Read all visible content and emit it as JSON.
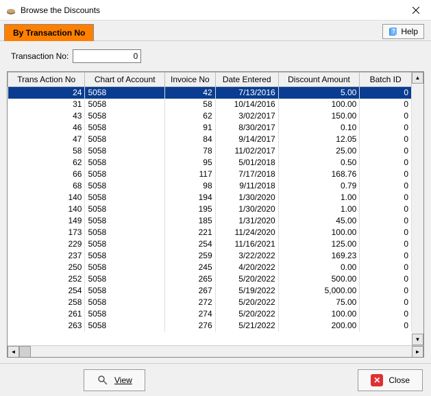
{
  "window": {
    "title": "Browse the Discounts"
  },
  "tab": {
    "label": "By Transaction No"
  },
  "help": {
    "label": "Help"
  },
  "filter": {
    "label": "Transaction No:",
    "value": "0"
  },
  "columns": [
    "Trans Action No",
    "Chart of Account",
    "Invoice No",
    "Date Entered",
    "Discount Amount",
    "Batch ID"
  ],
  "rows": [
    {
      "trans": "24",
      "chart": "5058",
      "inv": "42",
      "date": "7/13/2016",
      "disc": "5.00",
      "batch": "0",
      "selected": true
    },
    {
      "trans": "31",
      "chart": "5058",
      "inv": "58",
      "date": "10/14/2016",
      "disc": "100.00",
      "batch": "0"
    },
    {
      "trans": "43",
      "chart": "5058",
      "inv": "62",
      "date": "3/02/2017",
      "disc": "150.00",
      "batch": "0"
    },
    {
      "trans": "46",
      "chart": "5058",
      "inv": "91",
      "date": "8/30/2017",
      "disc": "0.10",
      "batch": "0"
    },
    {
      "trans": "47",
      "chart": "5058",
      "inv": "84",
      "date": "9/14/2017",
      "disc": "12.05",
      "batch": "0"
    },
    {
      "trans": "58",
      "chart": "5058",
      "inv": "78",
      "date": "11/02/2017",
      "disc": "25.00",
      "batch": "0"
    },
    {
      "trans": "62",
      "chart": "5058",
      "inv": "95",
      "date": "5/01/2018",
      "disc": "0.50",
      "batch": "0"
    },
    {
      "trans": "66",
      "chart": "5058",
      "inv": "117",
      "date": "7/17/2018",
      "disc": "168.76",
      "batch": "0"
    },
    {
      "trans": "68",
      "chart": "5058",
      "inv": "98",
      "date": "9/11/2018",
      "disc": "0.79",
      "batch": "0"
    },
    {
      "trans": "140",
      "chart": "5058",
      "inv": "194",
      "date": "1/30/2020",
      "disc": "1.00",
      "batch": "0"
    },
    {
      "trans": "140",
      "chart": "5058",
      "inv": "195",
      "date": "1/30/2020",
      "disc": "1.00",
      "batch": "0"
    },
    {
      "trans": "149",
      "chart": "5058",
      "inv": "185",
      "date": "1/31/2020",
      "disc": "45.00",
      "batch": "0"
    },
    {
      "trans": "173",
      "chart": "5058",
      "inv": "221",
      "date": "11/24/2020",
      "disc": "100.00",
      "batch": "0"
    },
    {
      "trans": "229",
      "chart": "5058",
      "inv": "254",
      "date": "11/16/2021",
      "disc": "125.00",
      "batch": "0"
    },
    {
      "trans": "237",
      "chart": "5058",
      "inv": "259",
      "date": "3/22/2022",
      "disc": "169.23",
      "batch": "0"
    },
    {
      "trans": "250",
      "chart": "5058",
      "inv": "245",
      "date": "4/20/2022",
      "disc": "0.00",
      "batch": "0"
    },
    {
      "trans": "252",
      "chart": "5058",
      "inv": "265",
      "date": "5/20/2022",
      "disc": "500.00",
      "batch": "0"
    },
    {
      "trans": "254",
      "chart": "5058",
      "inv": "267",
      "date": "5/19/2022",
      "disc": "5,000.00",
      "batch": "0"
    },
    {
      "trans": "258",
      "chart": "5058",
      "inv": "272",
      "date": "5/20/2022",
      "disc": "75.00",
      "batch": "0"
    },
    {
      "trans": "261",
      "chart": "5058",
      "inv": "274",
      "date": "5/20/2022",
      "disc": "100.00",
      "batch": "0"
    },
    {
      "trans": "263",
      "chart": "5058",
      "inv": "276",
      "date": "5/21/2022",
      "disc": "200.00",
      "batch": "0"
    }
  ],
  "buttons": {
    "view": "View",
    "close": "Close"
  }
}
